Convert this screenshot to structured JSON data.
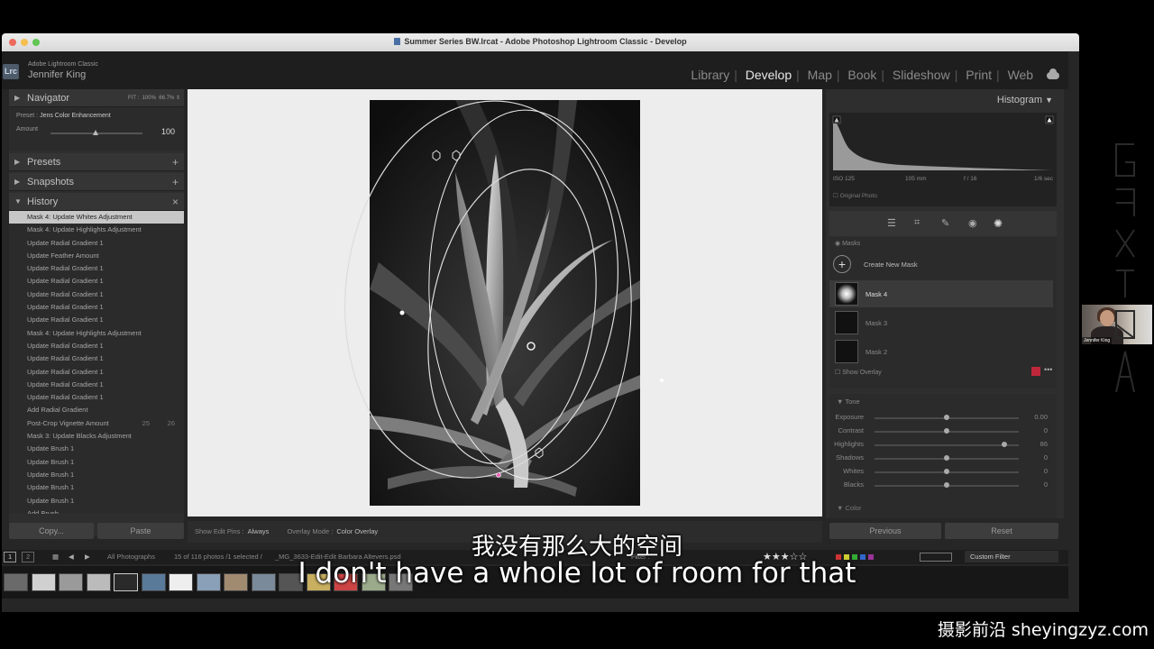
{
  "window": {
    "title": "Summer Series BW.lrcat - Adobe Photoshop Lightroom Classic - Develop"
  },
  "identity": {
    "logo": "Lrc",
    "product": "Adobe Lightroom Classic",
    "user": "Jennifer King"
  },
  "modules": [
    "Library",
    "Develop",
    "Map",
    "Book",
    "Slideshow",
    "Print",
    "Web"
  ],
  "active_module": "Develop",
  "navigator": {
    "label": "Navigator",
    "zoom_fit": "FIT :",
    "zoom_100": "100%",
    "zoom_other": "66.7%"
  },
  "preset": {
    "label": "Preset :",
    "name": "Jens Color Enhancement",
    "amount_label": "Amount",
    "amount_value": "100",
    "amount_fraction": 1.0
  },
  "panels": {
    "presets": "Presets",
    "snapshots": "Snapshots",
    "history": "History"
  },
  "history": [
    {
      "label": "Mask 4: Update Whites Adjustment",
      "selected": true
    },
    {
      "label": "Mask 4: Update Highlights Adjustment"
    },
    {
      "label": "Update Radial Gradient 1"
    },
    {
      "label": "Update Feather Amount"
    },
    {
      "label": "Update Radial Gradient 1"
    },
    {
      "label": "Update Radial Gradient 1"
    },
    {
      "label": "Update Radial Gradient 1"
    },
    {
      "label": "Update Radial Gradient 1"
    },
    {
      "label": "Update Radial Gradient 1"
    },
    {
      "label": "Mask 4: Update Highlights Adjustment"
    },
    {
      "label": "Update Radial Gradient 1"
    },
    {
      "label": "Update Radial Gradient 1"
    },
    {
      "label": "Update Radial Gradient 1"
    },
    {
      "label": "Update Radial Gradient 1"
    },
    {
      "label": "Update Radial Gradient 1"
    },
    {
      "label": "Add Radial Gradient"
    },
    {
      "label": "Post-Crop Vignette Amount",
      "v1": "25",
      "v2": "26"
    },
    {
      "label": "Mask 3: Update Blacks Adjustment"
    },
    {
      "label": "Update Brush 1"
    },
    {
      "label": "Update Brush 1"
    },
    {
      "label": "Update Brush 1"
    },
    {
      "label": "Update Brush 1"
    },
    {
      "label": "Update Brush 1"
    },
    {
      "label": "Add Brush"
    }
  ],
  "left_buttons": {
    "copy": "Copy...",
    "paste": "Paste"
  },
  "toolbar": {
    "show_pins_label": "Show Edit Pins :",
    "show_pins_value": "Always",
    "overlay_label": "Overlay Mode :",
    "overlay_value": "Color Overlay"
  },
  "histogram": {
    "label": "Histogram",
    "iso": "ISO 125",
    "focal": "105 mm",
    "aperture": "f / 16",
    "shutter": "1/6 sec",
    "original_photo": "Original Photo"
  },
  "masks": {
    "label": "Masks",
    "create": "Create New Mask",
    "items": [
      {
        "name": "Mask 4",
        "active": true
      },
      {
        "name": "Mask 3"
      },
      {
        "name": "Mask 2"
      }
    ],
    "show_overlay": "Show Overlay",
    "overlay_color": "#c0273a"
  },
  "tone": {
    "label": "Tone",
    "sliders": [
      {
        "name": "Exposure",
        "value": "0.00",
        "position": 0.5
      },
      {
        "name": "Contrast",
        "value": "0",
        "position": 0.5
      },
      {
        "name": "Highlights",
        "value": "86",
        "position": 0.9
      },
      {
        "name": "Shadows",
        "value": "0",
        "position": 0.5
      },
      {
        "name": "Whites",
        "value": "0",
        "position": 0.5
      },
      {
        "name": "Blacks",
        "value": "0",
        "position": 0.5
      }
    ],
    "color_label": "Color"
  },
  "right_buttons": {
    "previous": "Previous",
    "reset": "Reset"
  },
  "filmstrip": {
    "page1": "1",
    "page2": "2",
    "source": "All Photographs",
    "count": "15 of 116 photos /1 selected /",
    "filename": "_MG_3633-Edit-Edit Barbara Altevers.psd",
    "filter_label": "Filter :",
    "stars": "★★★☆☆",
    "custom_filter": "Custom Filter"
  },
  "video": {
    "participant": "Jennifer King",
    "subtitle_cn": "我没有那么大的空间",
    "subtitle_en": "I don't have a whole lot of room for that",
    "site": "摄影前沿 sheyingzyz.com"
  }
}
